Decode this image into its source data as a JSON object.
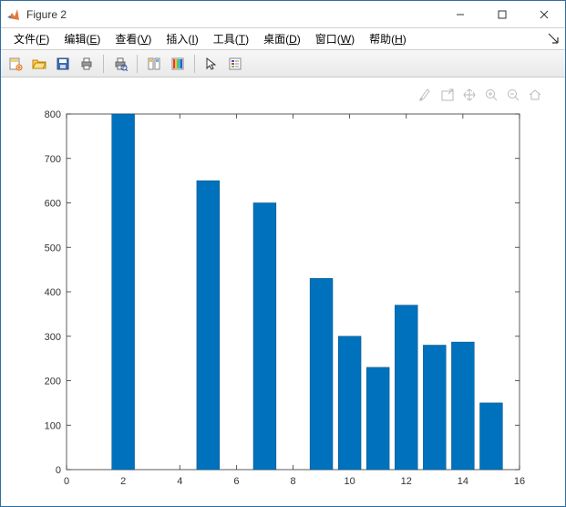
{
  "window": {
    "title": "Figure 2"
  },
  "menu": {
    "items": [
      {
        "label": "文件",
        "accel": "F"
      },
      {
        "label": "编辑",
        "accel": "E"
      },
      {
        "label": "查看",
        "accel": "V"
      },
      {
        "label": "插入",
        "accel": "I"
      },
      {
        "label": "工具",
        "accel": "T"
      },
      {
        "label": "桌面",
        "accel": "D"
      },
      {
        "label": "窗口",
        "accel": "W"
      },
      {
        "label": "帮助",
        "accel": "H"
      }
    ]
  },
  "toolbar_icons": [
    "new-figure-icon",
    "open-icon",
    "save-icon",
    "print-icon",
    "sep",
    "print-preview-icon",
    "sep",
    "link-icon",
    "colorbar-icon",
    "sep",
    "cursor-icon",
    "insert-legend-icon"
  ],
  "axes_toolbar_icons": [
    "brush-icon",
    "export-icon",
    "pan-icon",
    "zoom-in-icon",
    "zoom-out-icon",
    "home-icon"
  ],
  "chart_data": {
    "type": "bar",
    "categories": [
      2,
      5,
      7,
      9,
      10,
      11,
      12,
      13,
      14,
      15
    ],
    "values": [
      800,
      650,
      600,
      430,
      300,
      230,
      370,
      280,
      287,
      150
    ],
    "title": "",
    "xlabel": "",
    "ylabel": "",
    "xlim": [
      0,
      16
    ],
    "ylim": [
      0,
      800
    ],
    "xticks": [
      0,
      2,
      4,
      6,
      8,
      10,
      12,
      14,
      16
    ],
    "yticks": [
      0,
      100,
      200,
      300,
      400,
      500,
      600,
      700,
      800
    ],
    "bar_color": "#0072BD"
  }
}
